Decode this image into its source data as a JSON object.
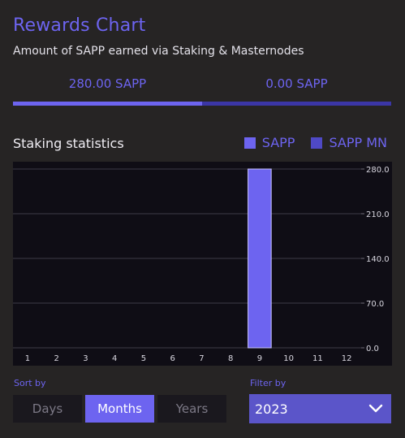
{
  "header": {
    "title": "Rewards Chart",
    "subtitle": "Amount of SAPP earned via Staking & Masternodes"
  },
  "totals": {
    "staking": "280.00 SAPP",
    "masternodes": "0.00 SAPP",
    "staking_share": 0.5
  },
  "stats": {
    "title": "Staking statistics",
    "legend": [
      {
        "label": "SAPP",
        "color": "#6d64f0"
      },
      {
        "label": "SAPP MN",
        "color": "#4f49c6"
      }
    ]
  },
  "chart_data": {
    "type": "bar",
    "categories": [
      "1",
      "2",
      "3",
      "4",
      "5",
      "6",
      "7",
      "8",
      "9",
      "10",
      "11",
      "12"
    ],
    "series": [
      {
        "name": "SAPP",
        "values": [
          0,
          0,
          0,
          0,
          0,
          0,
          0,
          0,
          280,
          0,
          0,
          0
        ],
        "color": "#6d64f0"
      },
      {
        "name": "SAPP MN",
        "values": [
          0,
          0,
          0,
          0,
          0,
          0,
          0,
          0,
          0,
          0,
          0,
          0
        ],
        "color": "#4f49c6"
      }
    ],
    "yticks": [
      "0.0",
      "70.0",
      "140.0",
      "210.0",
      "280.0"
    ],
    "ylim": [
      0,
      280
    ],
    "grid": true,
    "background": "#0f0d15"
  },
  "controls": {
    "sort_label": "Sort by",
    "sort_options": [
      "Days",
      "Months",
      "Years"
    ],
    "sort_selected": "Months",
    "filter_label": "Filter by",
    "filter_value": "2023",
    "chevron_icon": "chevron-down-icon"
  }
}
